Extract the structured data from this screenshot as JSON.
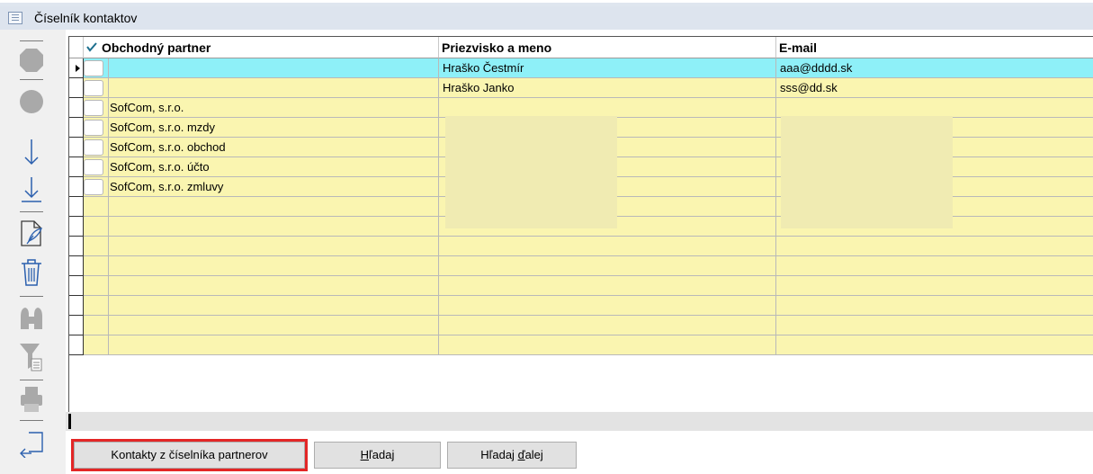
{
  "window": {
    "title": "Číselník kontaktov"
  },
  "toolbar": {
    "icons": [
      "first-record-icon",
      "prev-record-icon",
      "next-record-icon",
      "last-record-icon",
      "edit-icon",
      "delete-icon",
      "find-icon",
      "filter-icon",
      "print-icon",
      "exit-icon"
    ]
  },
  "grid": {
    "columns": [
      {
        "label": "Obchodný partner"
      },
      {
        "label": "Priezvisko a meno"
      },
      {
        "label": "E-mail"
      }
    ],
    "rows": [
      {
        "partner": "",
        "name": "Hraško Čestmír",
        "email": "aaa@dddd.sk",
        "selected": true
      },
      {
        "partner": "",
        "name": "Hraško Janko",
        "email": "sss@dd.sk",
        "selected": false
      },
      {
        "partner": "SofCom, s.r.o.",
        "name": "",
        "email": "",
        "selected": false
      },
      {
        "partner": "SofCom, s.r.o. mzdy",
        "name": "",
        "email": "",
        "selected": false
      },
      {
        "partner": "SofCom, s.r.o. obchod",
        "name": "",
        "email": "",
        "selected": false
      },
      {
        "partner": "SofCom, s.r.o. účto",
        "name": "",
        "email": "",
        "selected": false
      },
      {
        "partner": "SofCom, s.r.o. zmluvy",
        "name": "",
        "email": "",
        "selected": false
      }
    ],
    "empty_rows": 8
  },
  "buttons": {
    "contacts_from_partners": "Kontakty z číselníka partnerov",
    "find": "Hľadaj",
    "find_next": "Hľadaj ďalej"
  },
  "colors": {
    "row_bg": "#faf5b0",
    "selected_row_bg": "#8ef0f8",
    "highlight": "#e32626",
    "check": "#1d6f8e"
  }
}
